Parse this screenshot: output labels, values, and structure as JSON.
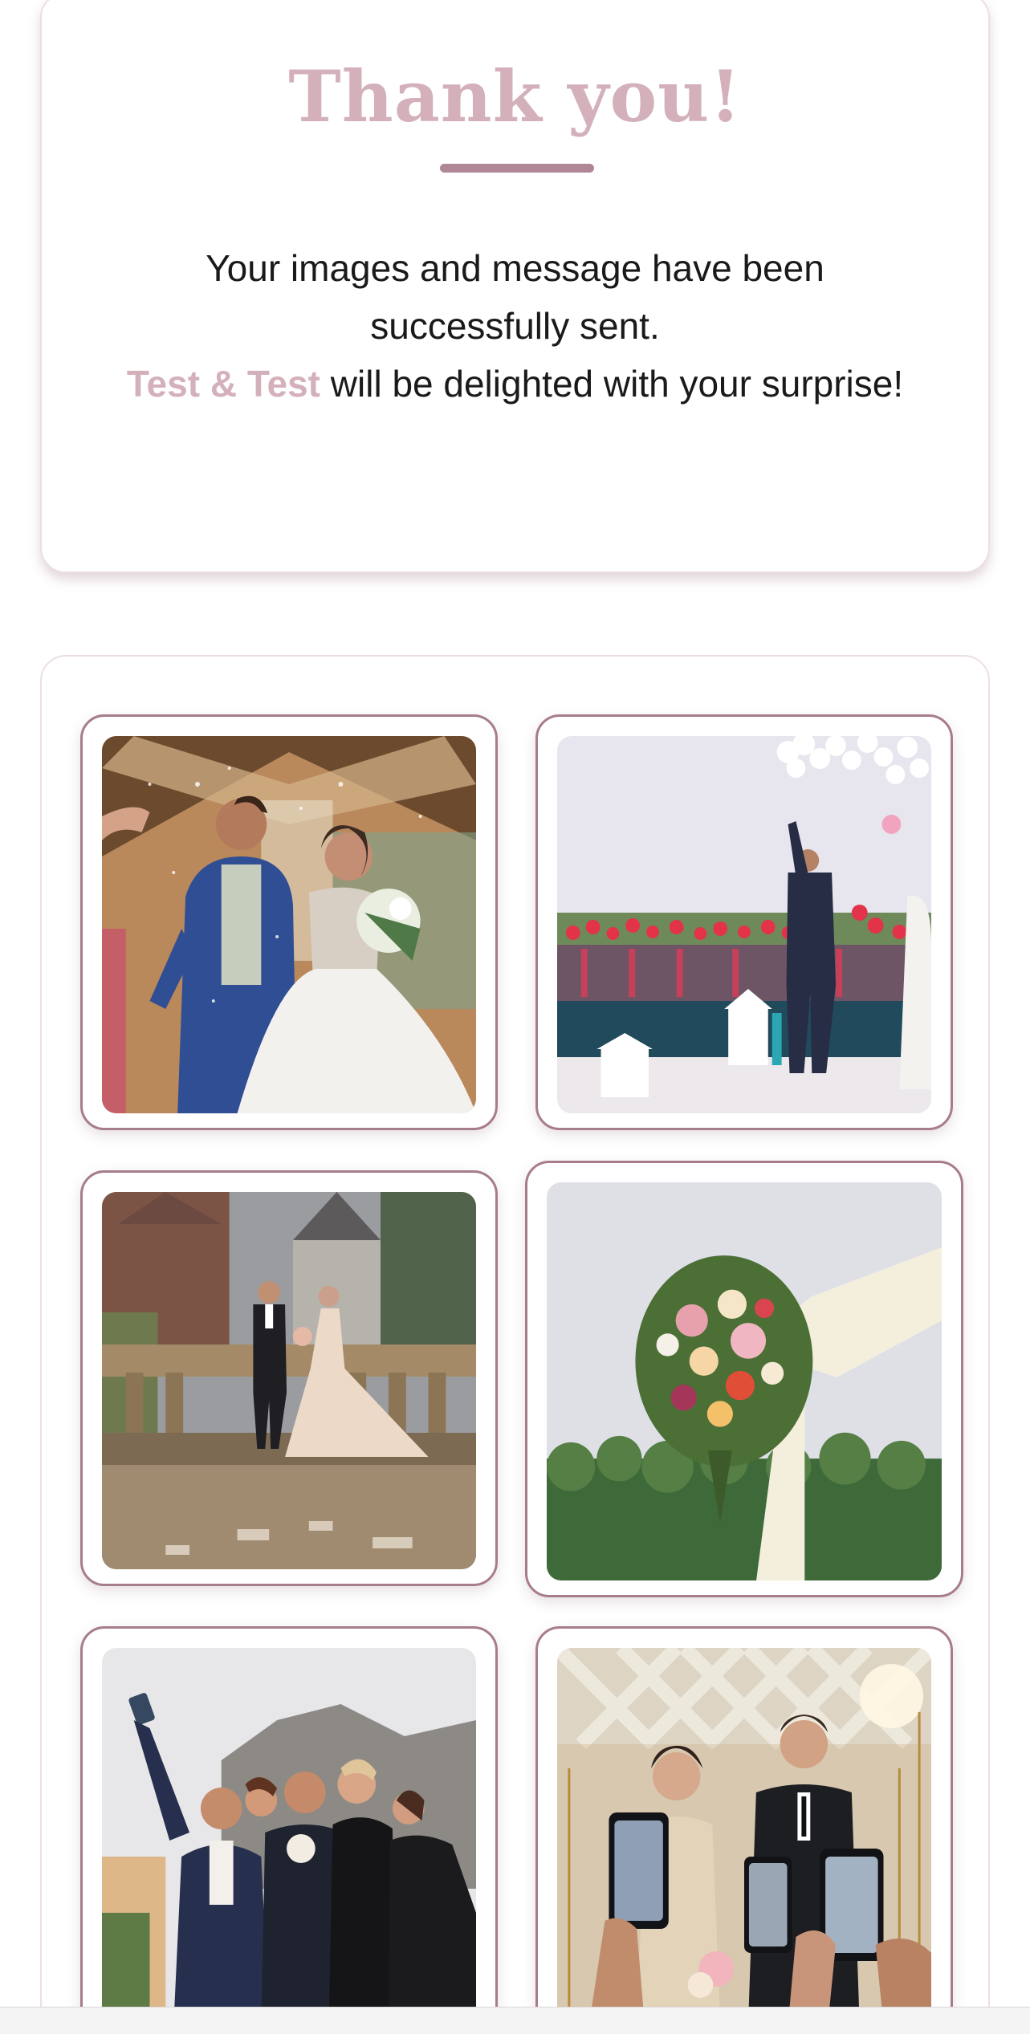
{
  "thank_you": {
    "title": "Thank you!",
    "message_line1": "Your images and message have been successfully sent.",
    "couple_name": "Test & Test",
    "message_line2": " will be delighted with your surprise!"
  },
  "gallery": {
    "images": [
      {
        "name": "Couple walking under falling confetti"
      },
      {
        "name": "Groom releasing balloons by the pool"
      },
      {
        "name": "Couple on stone terrace by castle"
      },
      {
        "name": "Bouquet on draped wedding arch"
      },
      {
        "name": "Group selfie with wedding party"
      },
      {
        "name": "Couple photographed with phones"
      }
    ]
  },
  "colors": {
    "accent": "#d4b1ba",
    "frame": "#a77c8c",
    "underline": "#b08797",
    "text": "#1a1a1a"
  }
}
